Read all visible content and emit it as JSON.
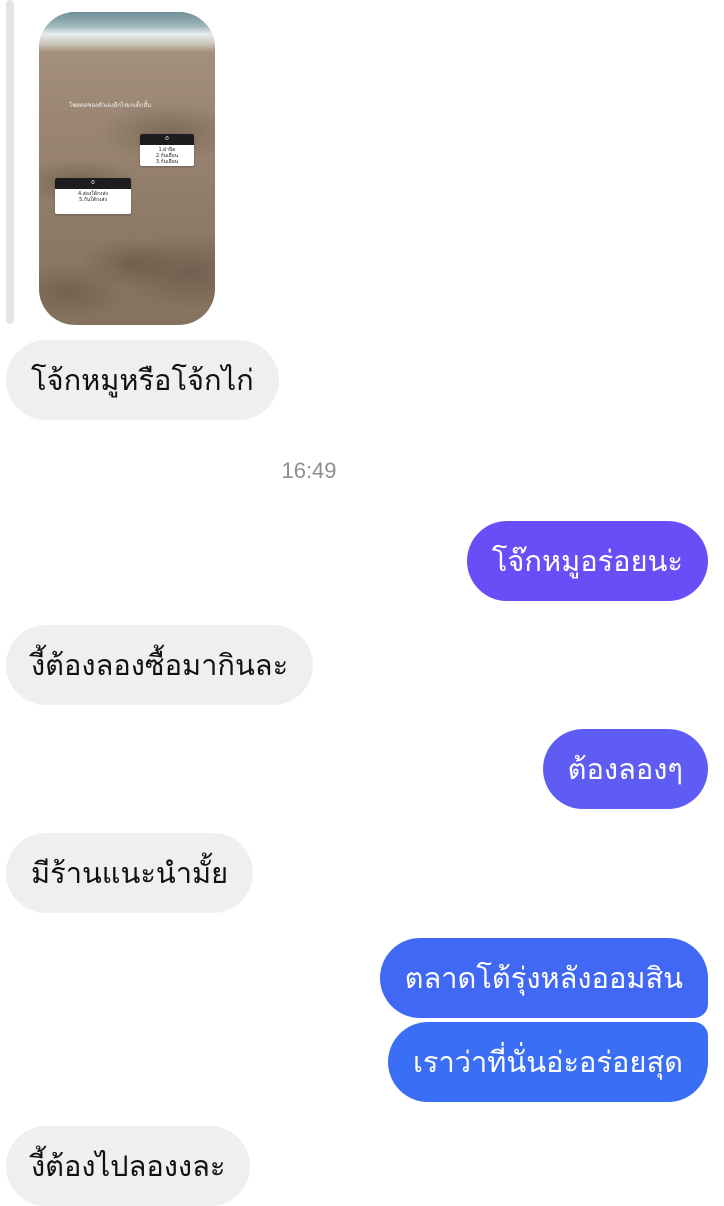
{
  "story_reply": {
    "headline": "โพสตอของตัวเองอีกไข่เกเด็กสั้น",
    "sticker_a": {
      "lines": [
        "1.ฝาปิด",
        "2.ก้นเยือน",
        "3.ก้นเยือน"
      ]
    },
    "sticker_b": {
      "lines": [
        "4.ส่องใต้กงส่ง",
        "5.ก้นใต้กงส่ง"
      ]
    }
  },
  "messages": [
    {
      "id": "m1",
      "direction": "incoming",
      "text": "โจ้กหมูหรือโจ้กไก่"
    },
    {
      "id": "m2",
      "direction": "outgoing",
      "text": "โจ๊กหมูอร่อยนะ"
    },
    {
      "id": "m3",
      "direction": "incoming",
      "text": "งี้ต้องลองซื้อมากินละ"
    },
    {
      "id": "m4",
      "direction": "outgoing",
      "text": "ต้องลองๆ"
    },
    {
      "id": "m5",
      "direction": "incoming",
      "text": "มีร้านแนะนำมั้ย"
    },
    {
      "id": "m6",
      "direction": "outgoing",
      "text": "ตลาดโต้รุ่งหลังออมสิน"
    },
    {
      "id": "m7",
      "direction": "outgoing",
      "text": "เราว่าที่นั่นอ่ะอร่อยสุด"
    },
    {
      "id": "m8",
      "direction": "incoming",
      "text": "งี้ต้องไปลองงละ"
    }
  ],
  "timestamp": "16:49",
  "colors": {
    "incoming_bubble": "#efefef",
    "outgoing_purple": "#6a4df6",
    "outgoing_indigo": "#5f5cf4",
    "outgoing_blue": "#3a6ff5"
  }
}
